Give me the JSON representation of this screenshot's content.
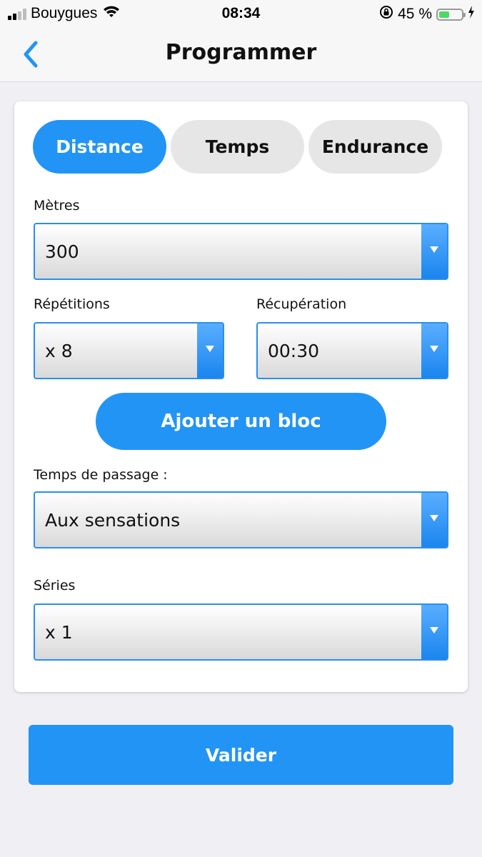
{
  "status_bar": {
    "carrier": "Bouygues",
    "time": "08:34",
    "battery_text": "45 %",
    "battery_level": 0.45,
    "battery_color": "#4cd964"
  },
  "nav": {
    "title": "Programmer",
    "back_icon": "chevron-left-icon",
    "accent_color": "#2294f5"
  },
  "tabs": [
    {
      "label": "Distance",
      "active": true
    },
    {
      "label": "Temps",
      "active": false
    },
    {
      "label": "Endurance",
      "active": false
    }
  ],
  "form": {
    "metres": {
      "label": "Mètres",
      "value": "300"
    },
    "repetitions": {
      "label": "Répétitions",
      "value": "x 8"
    },
    "recuperation": {
      "label": "Récupération",
      "value": "00:30"
    },
    "add_block_label": "Ajouter un bloc",
    "temps_passage": {
      "label": "Temps de passage :",
      "value": "Aux sensations"
    },
    "series": {
      "label": "Séries",
      "value": "x 1"
    }
  },
  "submit_label": "Valider"
}
